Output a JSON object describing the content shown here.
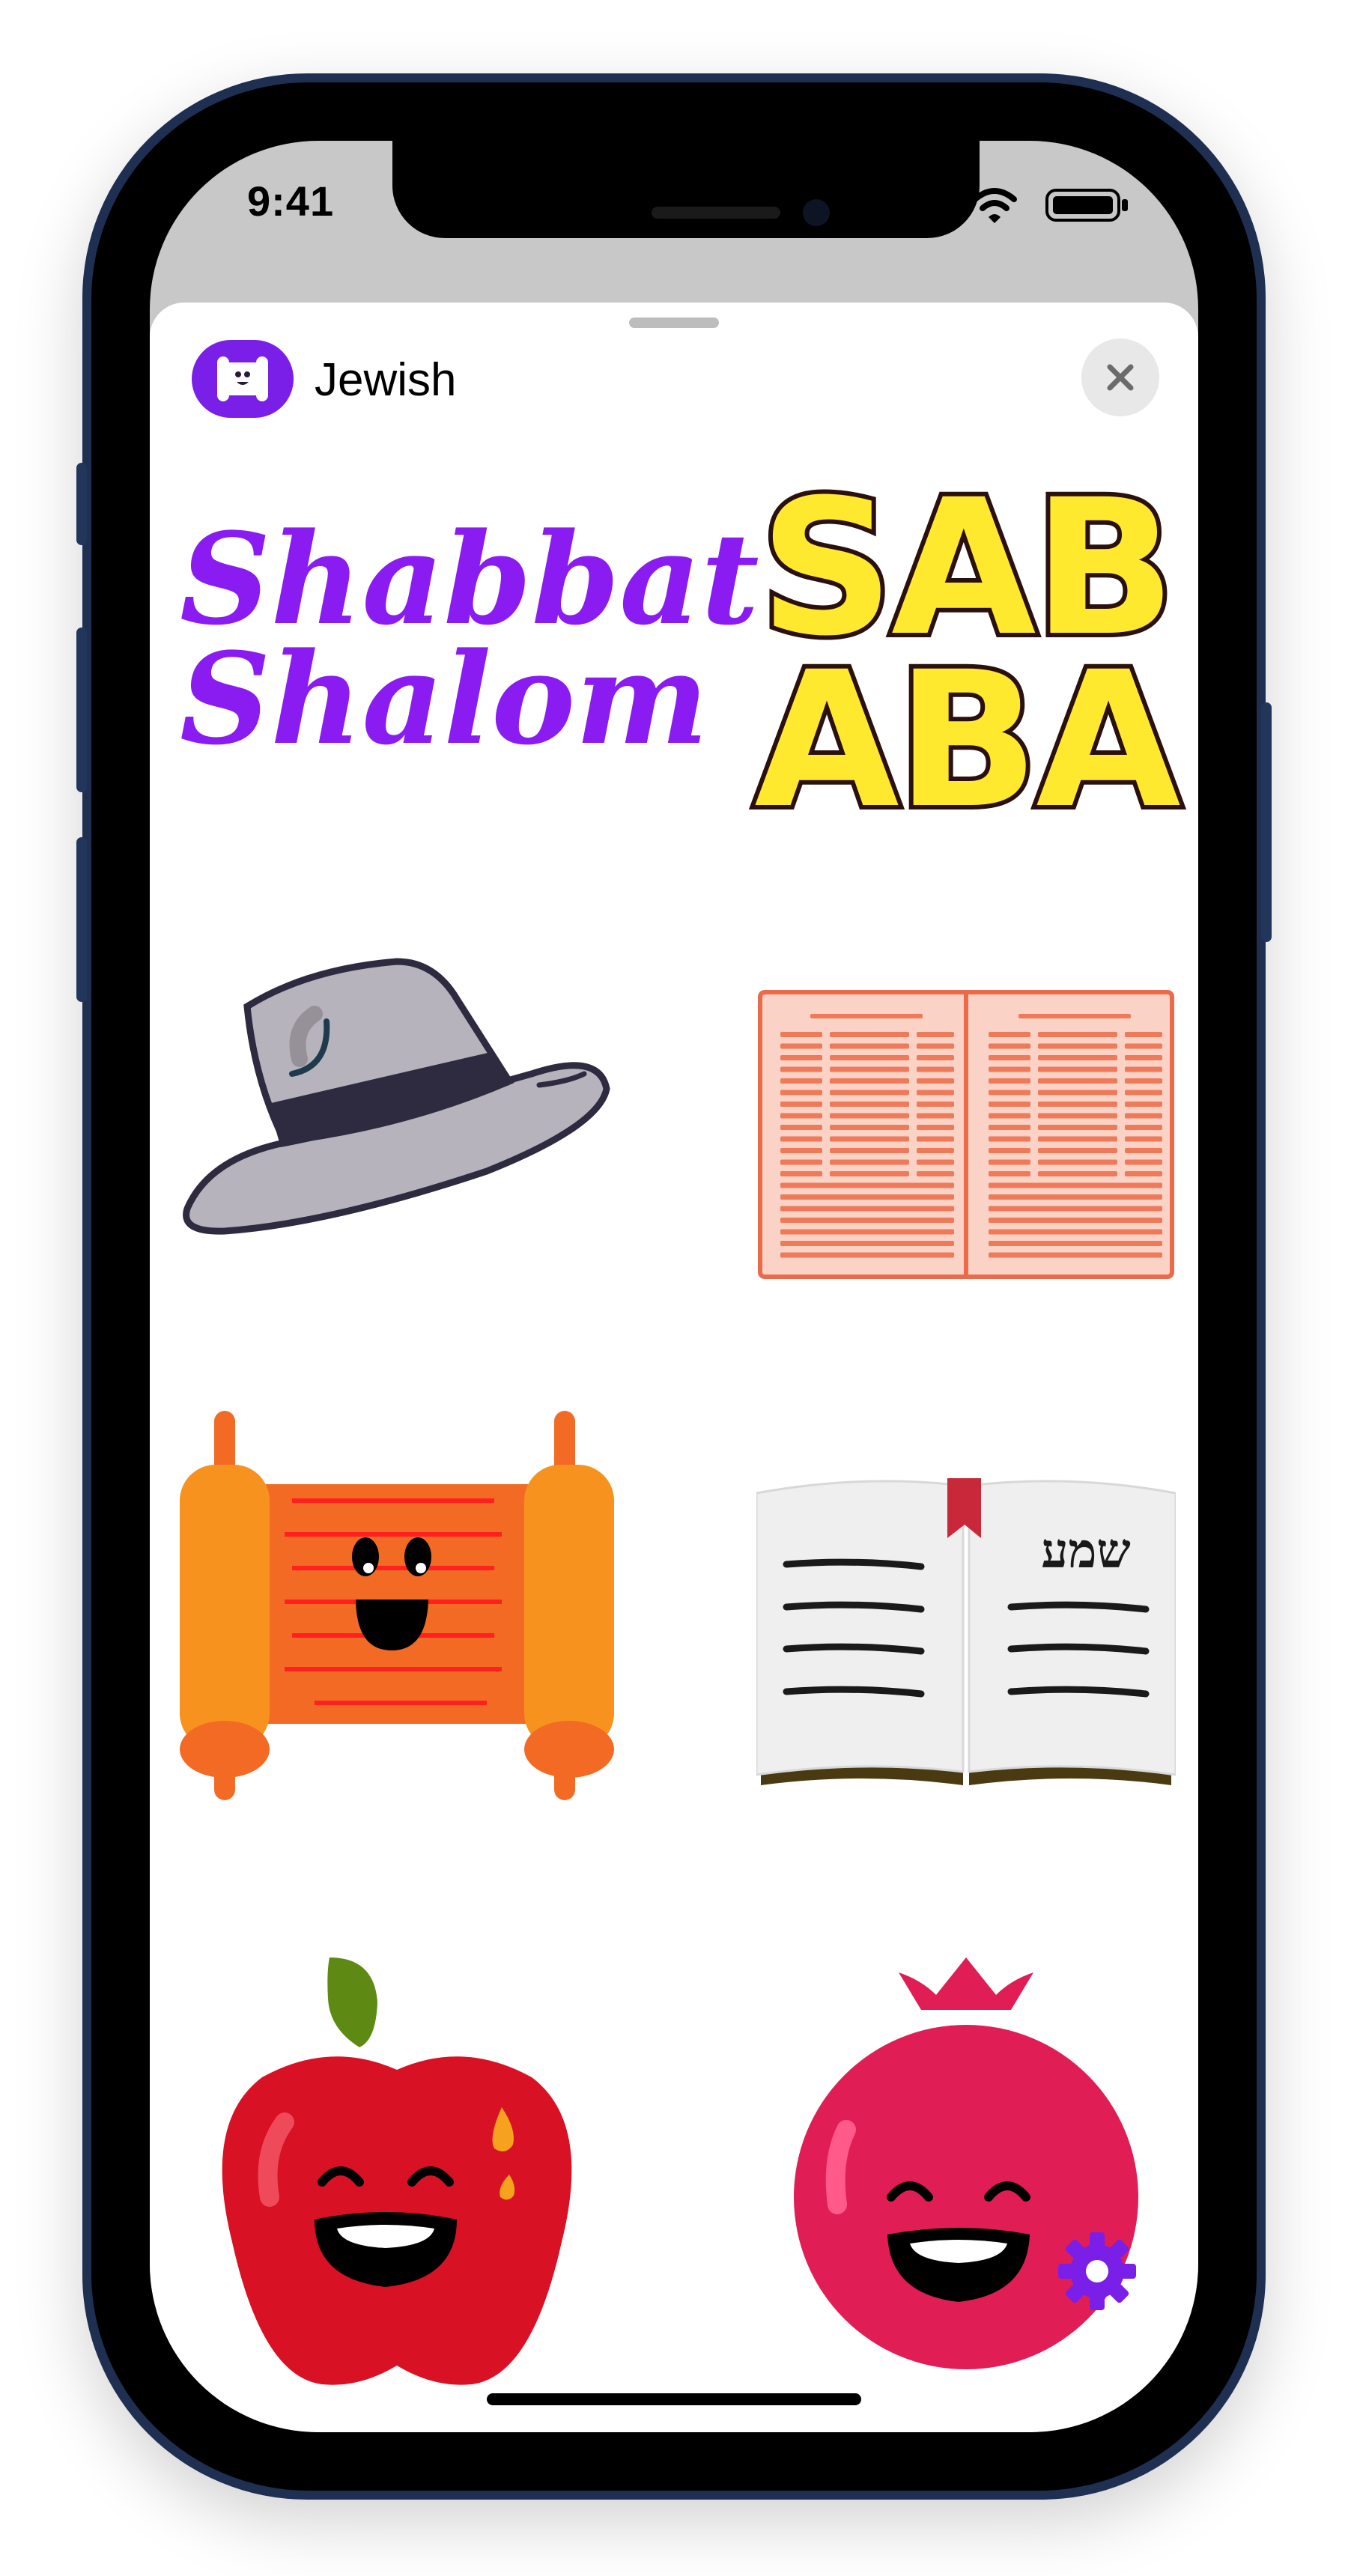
{
  "status_bar": {
    "time": "9:41"
  },
  "sheet": {
    "app_title": "Jewish",
    "app_icon": "torah-scroll-icon",
    "close_icon": "close-icon"
  },
  "stickers": [
    {
      "name": "shabbat-shalom",
      "line1": "Shabbat",
      "line2": "Shalom"
    },
    {
      "name": "sababa",
      "line1": "SAB",
      "line2": "ABA"
    },
    {
      "name": "fedora-hat"
    },
    {
      "name": "talmud-page"
    },
    {
      "name": "torah-scroll"
    },
    {
      "name": "shema-book",
      "text": "שמע"
    },
    {
      "name": "happy-apple"
    },
    {
      "name": "happy-pomegranate"
    }
  ],
  "settings_icon": "gear-icon",
  "colors": {
    "accent": "#8a1cf2",
    "sababa_yellow": "#ffe92e",
    "apple_red": "#d81124",
    "pomegranate": "#e01d55",
    "scroll_orange": "#f7921e"
  }
}
